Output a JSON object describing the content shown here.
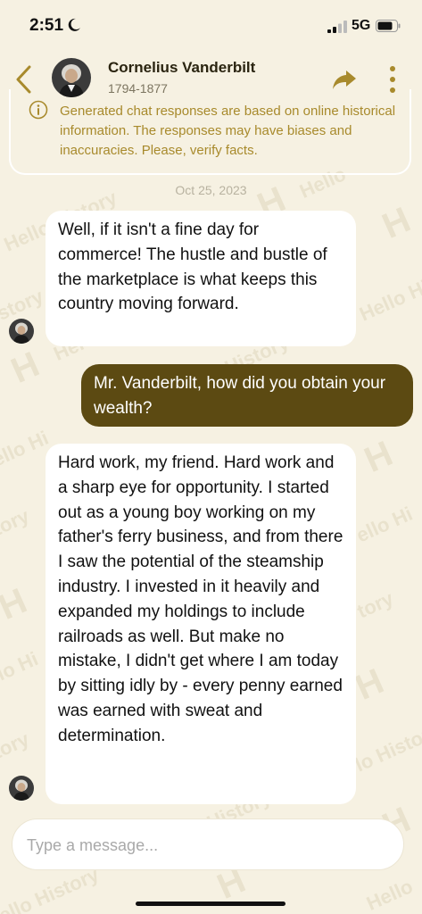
{
  "status_bar": {
    "time": "2:51",
    "network": "5G"
  },
  "header": {
    "name": "Cornelius Vanderbilt",
    "dates": "1794-1877"
  },
  "disclaimer": "Generated chat responses are based on online historical information. The responses may have biases and inaccuracies. Please, verify facts.",
  "date_separator": "Oct 25, 2023",
  "messages": [
    {
      "sender": "bot",
      "text": "Well, if it isn't a fine day for commerce! The hustle and bustle of the marketplace is what keeps this country moving forward."
    },
    {
      "sender": "user",
      "text": "Mr. Vanderbilt, how did you obtain your wealth?"
    },
    {
      "sender": "bot",
      "text": "Hard work, my friend. Hard work and a sharp eye for opportunity. I started out as a young boy working on my father's ferry business, and from there I saw the potential of the steamship industry. I invested in it heavily and expanded my holdings to include railroads as well. But make no mistake, I didn't get where I am today by sitting idly by - every penny earned was earned with sweat and determination."
    }
  ],
  "composer": {
    "placeholder": "Type a message..."
  },
  "colors": {
    "background": "#f6f1e2",
    "accent": "#a88a2c",
    "user_bubble": "#5c4a12",
    "bot_bubble": "#ffffff"
  }
}
